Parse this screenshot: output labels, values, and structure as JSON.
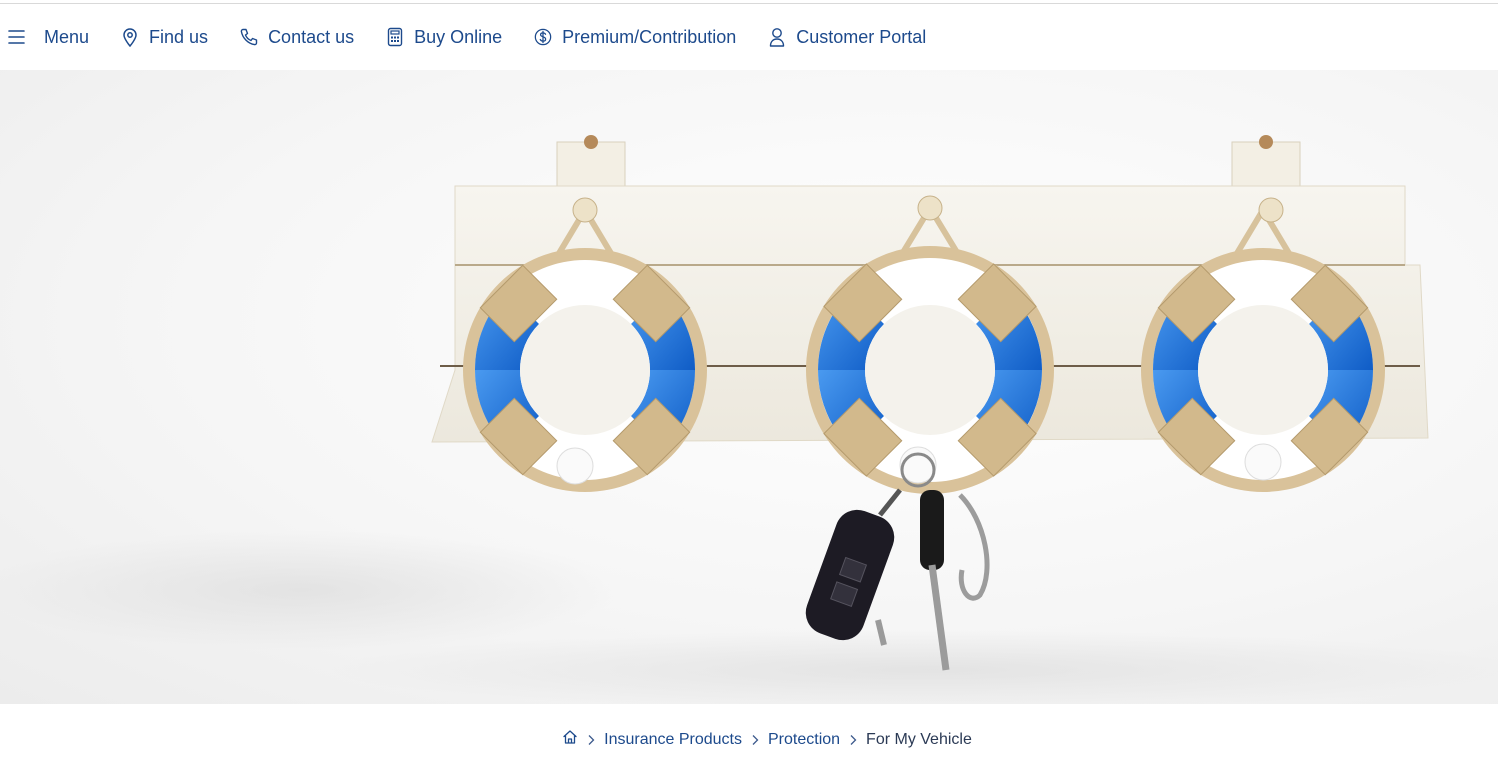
{
  "nav": {
    "items": [
      {
        "label": "Menu",
        "icon": "hamburger-icon"
      },
      {
        "label": "Find us",
        "icon": "location-pin-icon"
      },
      {
        "label": "Contact us",
        "icon": "phone-icon"
      },
      {
        "label": "Buy Online",
        "icon": "calculator-icon"
      },
      {
        "label": "Premium/Contribution",
        "icon": "dollar-coin-icon"
      },
      {
        "label": "Customer Portal",
        "icon": "user-icon"
      }
    ]
  },
  "breadcrumb": {
    "home_icon": "home-icon",
    "separator_icon": "chevron-right-icon",
    "items": [
      "Insurance Products",
      "Protection"
    ],
    "current": "For My Vehicle"
  },
  "colors": {
    "link": "#1d4a8c",
    "hero_background": "#f4f4f4",
    "lifebuoy_blue": "#1f6fd1",
    "rope": "#d9c29a",
    "board": "#f3f1ea"
  }
}
